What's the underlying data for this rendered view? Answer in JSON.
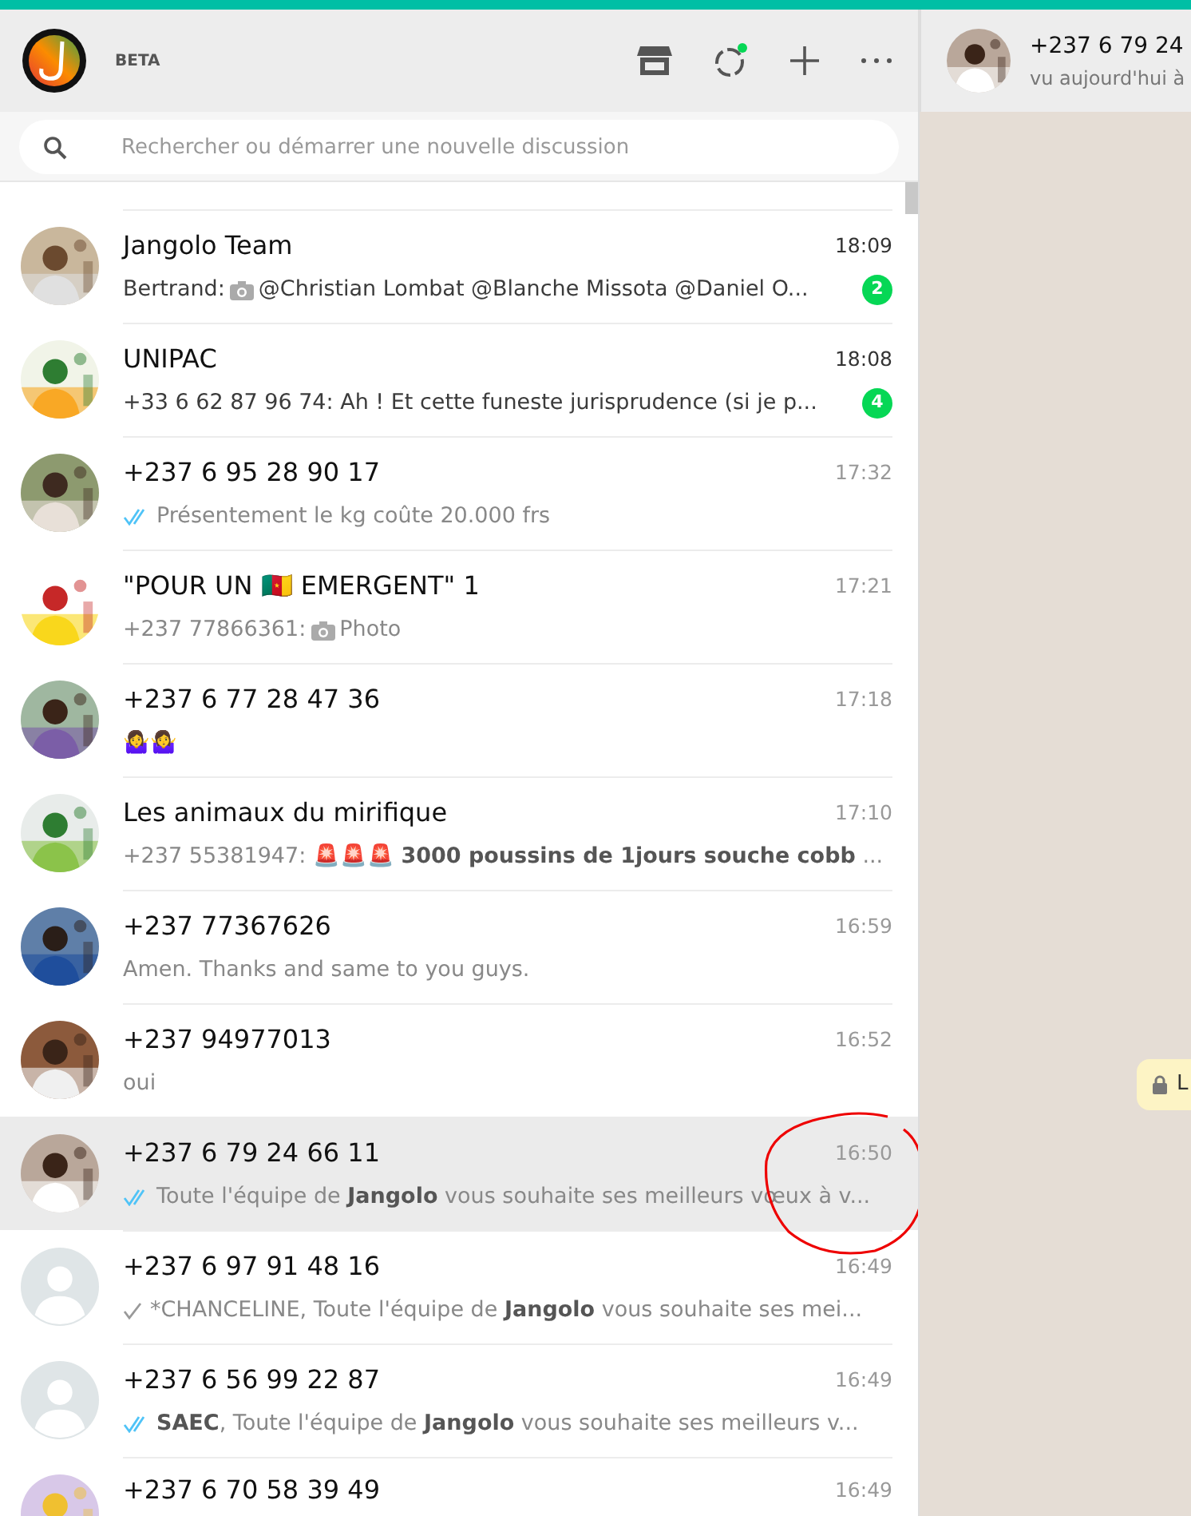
{
  "app": {
    "badge": "BETA"
  },
  "search": {
    "placeholder": "Rechercher ou démarrer une nouvelle discussion"
  },
  "chats": [
    {
      "name": "Jangolo Team",
      "time": "18:09",
      "kind": "picture",
      "unread": true,
      "count": "2",
      "sender": "Bertrand:",
      "photo": true,
      "preview": "@Christian Lombat @Blanche Missota @Daniel O...",
      "selected": false
    },
    {
      "name": "UNIPAC",
      "time": "18:08",
      "kind": "picture",
      "unread": true,
      "count": "4",
      "preview": "+33 6 62 87 96 74: Ah ! Et cette funeste  jurisprudence (si je p...",
      "selected": false
    },
    {
      "name": "+237 6 95 28 90 17",
      "time": "17:32",
      "kind": "picture",
      "unread": false,
      "sent": true,
      "read": true,
      "preview": "Présentement le kg coûte 20.000 frs",
      "selected": false
    },
    {
      "name": "\"POUR UN 🇨🇲 EMERGENT\" 1",
      "time": "17:21",
      "kind": "picture",
      "unread": false,
      "sender": "+237 77866361:",
      "photo": true,
      "preview": "Photo",
      "selected": false
    },
    {
      "name": "+237 6 77 28 47 36",
      "time": "17:18",
      "kind": "picture",
      "unread": false,
      "preview": "🤷‍♀️🤷‍♀️",
      "selected": false
    },
    {
      "name": "Les animaux du mirifique",
      "time": "17:10",
      "kind": "picture",
      "unread": false,
      "preview": "+237 55381947: 🚨🚨🚨 **3000 poussins de 1jours souche cobb** ...",
      "selected": false
    },
    {
      "name": "+237 77367626",
      "time": "16:59",
      "kind": "picture",
      "unread": false,
      "preview": "Amen. Thanks and same to you guys.",
      "selected": false
    },
    {
      "name": "+237 94977013",
      "time": "16:52",
      "kind": "picture",
      "unread": false,
      "preview": "oui",
      "selected": false
    },
    {
      "name": "+237 6 79 24 66 11",
      "time": "16:50",
      "kind": "picture",
      "unread": false,
      "sent": true,
      "read": true,
      "preview": "Toute l'équipe de **Jangolo** vous souhaite ses meilleurs vœux à v...",
      "selected": true
    },
    {
      "name": "+237 6 97 91 48 16",
      "time": "16:49",
      "kind": "default",
      "unread": false,
      "sent": true,
      "read": false,
      "preview": "*CHANCELINE,  Toute l'équipe de **Jangolo** vous souhaite ses mei...",
      "selected": false
    },
    {
      "name": "+237 6 56 99 22 87",
      "time": "16:49",
      "kind": "default",
      "unread": false,
      "sent": true,
      "read": true,
      "preview": "**SAEC**,  Toute l'équipe de **Jangolo** vous souhaite ses meilleurs v...",
      "selected": false
    },
    {
      "name": "+237 6 70 58 39 49",
      "time": "16:49",
      "kind": "picture",
      "selected": false
    }
  ],
  "conversation": {
    "title": "+237 6 79 24",
    "subtitle": "vu aujourd'hui à",
    "notice": "L"
  }
}
